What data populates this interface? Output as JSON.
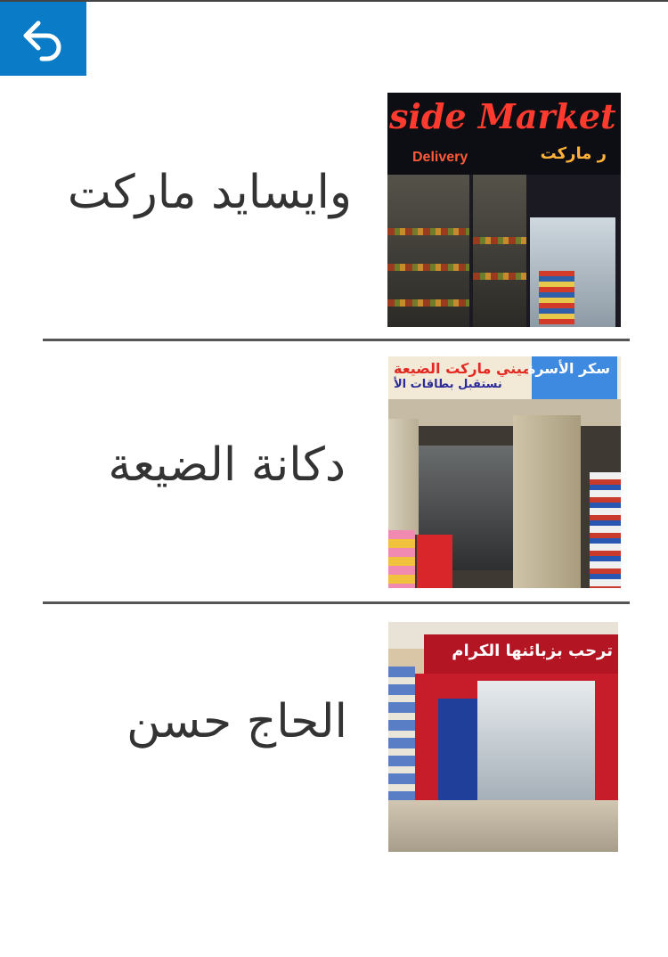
{
  "header": {
    "back_icon": "back-arrow-icon",
    "back_color": "#0a7cc7"
  },
  "stores": [
    {
      "name": "وايسايد ماركت",
      "photo": {
        "sign_text_en": "side Market",
        "sign_text_delivery": "Delivery",
        "sign_text_ar": "ر ماركت"
      }
    },
    {
      "name": "دكانة الضيعة",
      "photo": {
        "banner_text_ar": "ميني ماركت الضيعة",
        "banner_subtext_ar": "نستقبل بطاقات الأ",
        "banner_blue_text_ar": "سكر الأسرة"
      }
    },
    {
      "name": "الحاج حسن",
      "photo": {
        "sign_text_ar": "ترحب بزبائنها الكرام"
      }
    }
  ]
}
